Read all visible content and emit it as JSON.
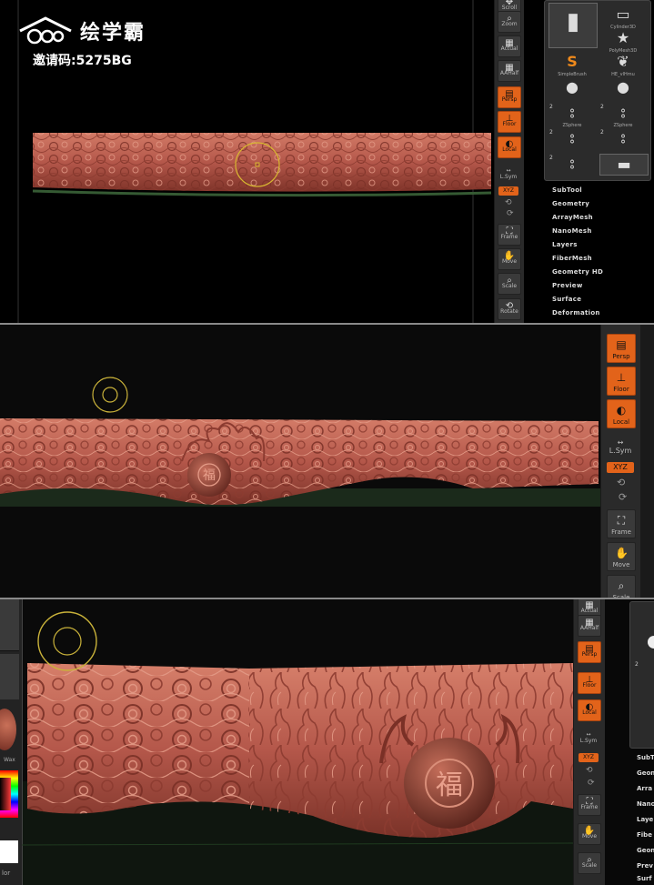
{
  "watermark": {
    "brand": "绘学霸",
    "invite_code": "邀请码:5275BG"
  },
  "shelf": {
    "scroll": "Scroll",
    "zoom": "Zoom",
    "actual": "Actual",
    "aahalf": "AAHalf",
    "dynamic": "Dynamic",
    "persp": "Persp",
    "floor": "Floor",
    "local": "Local",
    "lsym": "L.Sym",
    "xyz": "XYZ",
    "frame": "Frame",
    "move": "Move",
    "scale": "Scale",
    "rotate": "Rotate"
  },
  "tools": [
    {
      "name": "Cylinder3D",
      "icon": "cylinder-icon"
    },
    {
      "name": "PolyMesh3D",
      "icon": "star-icon"
    },
    {
      "name": "SimpleBrush",
      "icon": "s-icon"
    },
    {
      "name": "HE_vIHmu",
      "icon": "sphere-icon"
    },
    {
      "name": "ZSphere",
      "icon": "zsphere-icon"
    },
    {
      "name": "ZSphere",
      "icon": "zsphere-icon"
    }
  ],
  "tool_counts": [
    "2",
    "2",
    "2",
    "2",
    "2"
  ],
  "menus": [
    "SubTool",
    "Geometry",
    "ArrayMesh",
    "NanoMesh",
    "Layers",
    "FiberMesh",
    "Geometry HD",
    "Preview",
    "Surface",
    "Deformation"
  ],
  "menus_cut": [
    "SubT",
    "Geon",
    "Arra",
    "Nano",
    "Laye",
    "Fibe",
    "Geon",
    "Prev",
    "Surf"
  ],
  "left_labels": [
    "Wax",
    "lor"
  ],
  "colors": {
    "accent": "#e2631a",
    "clay": "#b4574a",
    "background": "#000000"
  }
}
